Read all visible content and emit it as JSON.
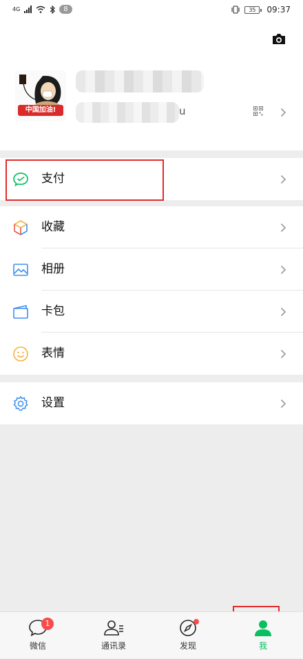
{
  "status_bar": {
    "network_label": "4G",
    "badge": "8",
    "battery": "35",
    "time": "09:37"
  },
  "profile": {
    "avatar_banner": "中国加油!",
    "wechat_id_suffix": "u"
  },
  "menu": {
    "pay": "支付",
    "favorites": "收藏",
    "album": "相册",
    "cards": "卡包",
    "stickers": "表情",
    "settings": "设置"
  },
  "tabs": {
    "chats": "微信",
    "chats_badge": "1",
    "contacts": "通讯录",
    "discover": "发现",
    "me": "我"
  },
  "colors": {
    "accent_green": "#07c160",
    "highlight_red": "#e02b2b",
    "badge_red": "#f74c4c"
  }
}
